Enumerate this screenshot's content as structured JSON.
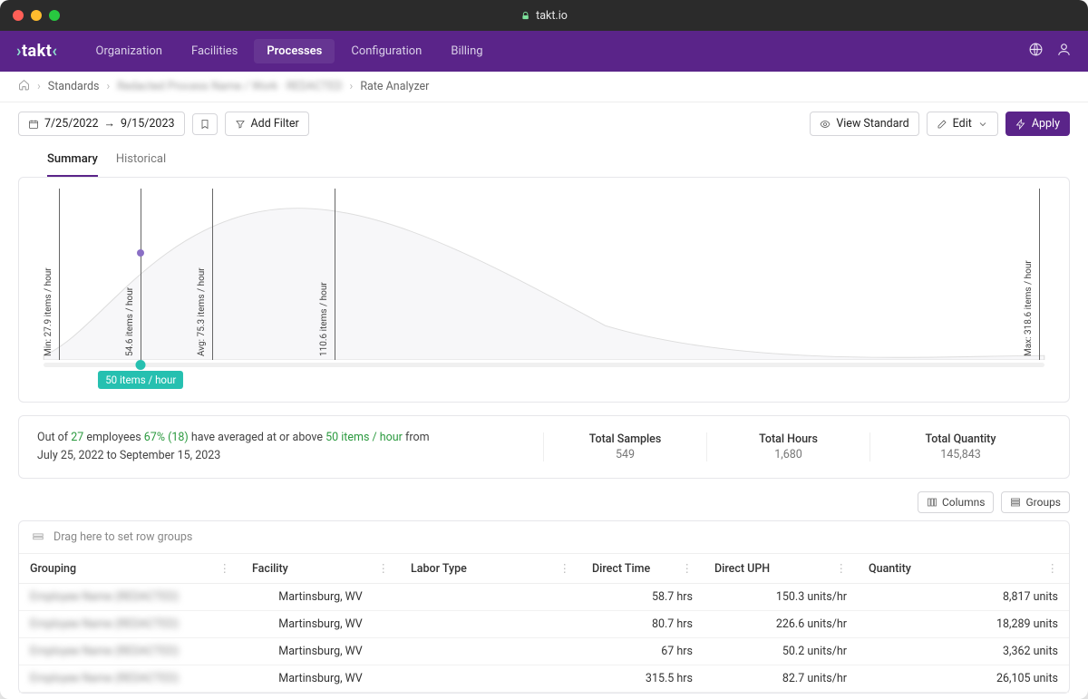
{
  "browser": {
    "url": "takt.io"
  },
  "brand": "takt",
  "nav": {
    "items": [
      {
        "label": "Organization"
      },
      {
        "label": "Facilities"
      },
      {
        "label": "Processes",
        "active": true
      },
      {
        "label": "Configuration"
      },
      {
        "label": "Billing"
      }
    ]
  },
  "breadcrumb": {
    "standards": "Standards",
    "hidden": "Redacted Process Name / Work · REDACTED",
    "current": "Rate Analyzer"
  },
  "toolbar": {
    "date_from": "7/25/2022",
    "date_to": "9/15/2023",
    "add_filter": "Add Filter",
    "view_standard": "View Standard",
    "edit": "Edit",
    "apply": "Apply"
  },
  "tabs": {
    "summary": "Summary",
    "historical": "Historical"
  },
  "chart_data": {
    "type": "area",
    "xlabel": "items / hour",
    "markers": [
      {
        "label": "Min: 27.9 items / hour",
        "pos_pct": 2.5
      },
      {
        "label": "54.6 items / hour",
        "pos_pct": 10.5
      },
      {
        "label": "Avg: 75.3 items / hour",
        "pos_pct": 17.5
      },
      {
        "label": "110.6 items / hour",
        "pos_pct": 29.5
      },
      {
        "label": "Max: 318.6 items / hour",
        "pos_pct": 98.5
      }
    ],
    "selected_dot": {
      "x_pct": 10.5,
      "y_pct": 33
    },
    "slider": {
      "value_label": "50 items / hour",
      "pos_pct": 10.5,
      "min": 27.9,
      "max": 318.6,
      "value": 50
    }
  },
  "summary": {
    "prefix": "Out of ",
    "emp_count": "27",
    "emp_word": " employees ",
    "pct": "67% (18)",
    "mid": " have averaged at or above ",
    "rate": "50 items / hour",
    "suffix": " from ",
    "range": "July 25, 2022 to September 15, 2023"
  },
  "stats": {
    "samples_label": "Total Samples",
    "samples_value": "549",
    "hours_label": "Total Hours",
    "hours_value": "1,680",
    "qty_label": "Total Quantity",
    "qty_value": "145,843"
  },
  "table_controls": {
    "columns": "Columns",
    "groups": "Groups"
  },
  "grid": {
    "groupbar_hint": "Drag here to set row groups",
    "columns": [
      "Grouping",
      "Facility",
      "Labor Type",
      "Direct Time",
      "Direct UPH",
      "Quantity"
    ],
    "rows": [
      {
        "grouping": "Employee Name (REDACTED)",
        "facility": "Martinsburg, WV",
        "labor": "",
        "direct_time": "58.7 hrs",
        "direct_uph": "150.3 units/hr",
        "quantity": "8,817 units"
      },
      {
        "grouping": "Employee Name (REDACTED)",
        "facility": "Martinsburg, WV",
        "labor": "",
        "direct_time": "80.7 hrs",
        "direct_uph": "226.6 units/hr",
        "quantity": "18,289 units"
      },
      {
        "grouping": "Employee Name (REDACTED)",
        "facility": "Martinsburg, WV",
        "labor": "",
        "direct_time": "67 hrs",
        "direct_uph": "50.2 units/hr",
        "quantity": "3,362 units"
      },
      {
        "grouping": "Employee Name (REDACTED)",
        "facility": "Martinsburg, WV",
        "labor": "",
        "direct_time": "315.5 hrs",
        "direct_uph": "82.7 units/hr",
        "quantity": "26,105 units"
      }
    ]
  }
}
